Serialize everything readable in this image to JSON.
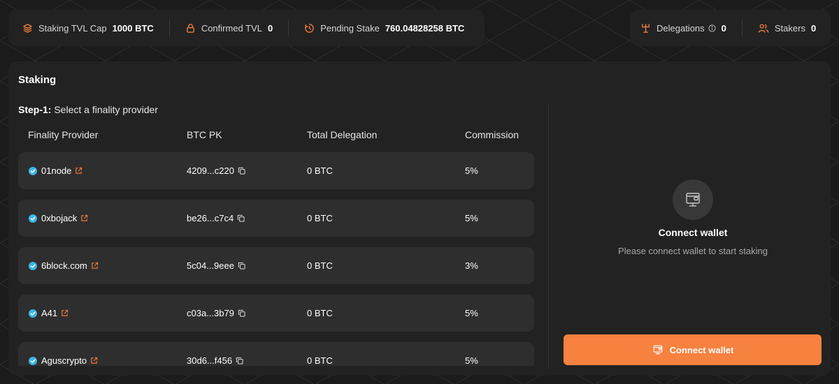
{
  "stats": {
    "tvl_cap": {
      "label": "Staking TVL Cap",
      "value": "1000 BTC"
    },
    "confirmed_tvl": {
      "label": "Confirmed TVL",
      "value": "0"
    },
    "pending_stake": {
      "label": "Pending Stake",
      "value": "760.04828258 BTC"
    },
    "delegations": {
      "label": "Delegations",
      "value": "0"
    },
    "stakers": {
      "label": "Stakers",
      "value": "0"
    }
  },
  "panel": {
    "title": "Staking",
    "step_prefix": "Step-1:",
    "step_text": "Select a finality provider"
  },
  "table": {
    "headers": [
      "Finality Provider",
      "BTC PK",
      "Total Delegation",
      "Commission"
    ],
    "rows": [
      {
        "name": "01node",
        "pk": "4209...c220",
        "delegation": "0 BTC",
        "commission": "5%"
      },
      {
        "name": "0xbojack",
        "pk": "be26...c7c4",
        "delegation": "0 BTC",
        "commission": "5%"
      },
      {
        "name": "6block.com",
        "pk": "5c04...9eee",
        "delegation": "0 BTC",
        "commission": "3%"
      },
      {
        "name": "A41",
        "pk": "c03a...3b79",
        "delegation": "0 BTC",
        "commission": "5%"
      },
      {
        "name": "Agu­scrypto",
        "pk": "30d6...f456",
        "delegation": "0 BTC",
        "commission": "5%"
      }
    ]
  },
  "wallet": {
    "title": "Connect wallet",
    "subtitle": "Please connect wallet to start staking",
    "button_label": "Connect wallet"
  },
  "colors": {
    "accent": "#f7813f",
    "verified": "#3cb4e6",
    "panel": "#222222",
    "row": "#2e2e2e"
  },
  "icons": {
    "tvl_cap": "layers-icon",
    "confirmed_tvl": "lock-icon",
    "pending_stake": "clock-icon",
    "delegations": "hierarchy-icon",
    "stakers": "users-icon",
    "verified": "verified-check-icon",
    "external_link": "external-link-icon",
    "copy": "copy-icon",
    "wallet": "wallet-icon"
  }
}
